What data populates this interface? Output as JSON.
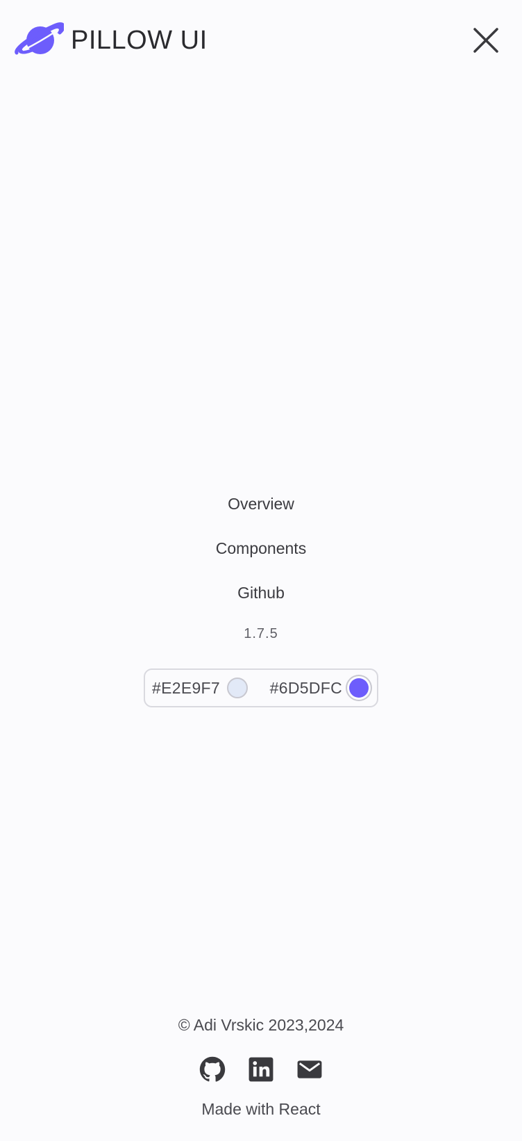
{
  "brand": {
    "name": "PILLOW UI",
    "logo_icon": "planet-icon",
    "accent_color": "#6D5DFC"
  },
  "header": {
    "close_icon": "close-icon"
  },
  "nav": {
    "items": [
      {
        "label": "Overview"
      },
      {
        "label": "Components"
      },
      {
        "label": "Github"
      }
    ],
    "version": "1.7.5"
  },
  "theme_picker": {
    "light": {
      "label": "#E2E9F7",
      "color": "#E2E9F7"
    },
    "dark": {
      "label": "#6D5DFC",
      "color": "#6D5DFC",
      "selected": true
    }
  },
  "footer": {
    "copyright": "© Adi Vrskic 2023,2024",
    "social": [
      {
        "icon": "github-icon"
      },
      {
        "icon": "linkedin-icon"
      },
      {
        "icon": "email-icon"
      }
    ],
    "made_with": "Made with React"
  }
}
